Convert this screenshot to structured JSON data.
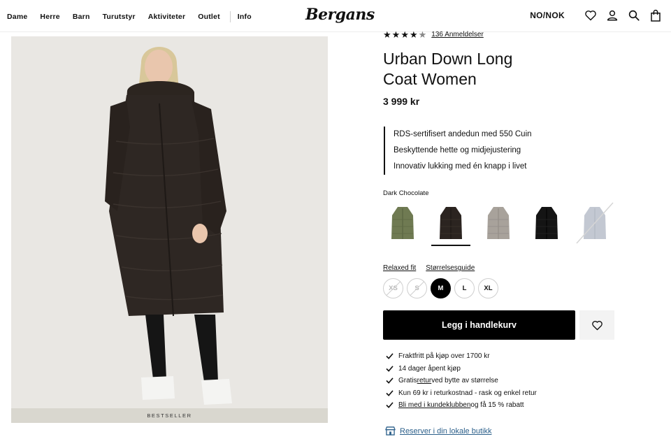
{
  "nav": {
    "items": [
      "Dame",
      "Herre",
      "Barn",
      "Turutstyr",
      "Aktiviteter",
      "Outlet",
      "Info"
    ],
    "logo": "Bergans",
    "locale": "NO/NOK"
  },
  "product": {
    "badge": "BESTSELLER",
    "rating": {
      "stars": 4.5,
      "reviews_label": "136 Anmeldelser"
    },
    "title_line1": "Urban Down Long",
    "title_line2": "Coat Women",
    "price": "3 999 kr",
    "features": [
      "RDS-sertifisert andedun med 550 Cuin",
      "Beskyttende hette og midjejustering",
      "Innovativ lukking med én knapp i livet"
    ],
    "color_label": "Dark Chocolate",
    "swatches": [
      {
        "color": "#6f7a52",
        "selected": false,
        "disabled": false
      },
      {
        "color": "#2b2420",
        "selected": true,
        "disabled": false
      },
      {
        "color": "#a8a29b",
        "selected": false,
        "disabled": false
      },
      {
        "color": "#141414",
        "selected": false,
        "disabled": false
      },
      {
        "color": "#c3c8d2",
        "selected": false,
        "disabled": true
      }
    ],
    "fit_link": "Relaxed fit",
    "size_guide_link": "Størrelsesguide",
    "sizes": [
      {
        "label": "XS",
        "state": "disabled"
      },
      {
        "label": "S",
        "state": "disabled"
      },
      {
        "label": "M",
        "state": "selected"
      },
      {
        "label": "L",
        "state": "available"
      },
      {
        "label": "XL",
        "state": "available"
      }
    ],
    "add_to_cart": "Legg i handlekurv",
    "benefits": {
      "b1": "Fraktfritt på kjøp over 1700 kr",
      "b2": "14 dager åpent kjøp",
      "b3_pre": "Gratis ",
      "b3_link": "retur",
      "b3_post": " ved bytte av størrelse",
      "b4": "Kun 69 kr i returkostnad - rask og enkel retur",
      "b5_link": "Bli med i kundeklubben",
      "b5_post": " og få 15 % rabatt"
    },
    "store_link": "Reserver i din lokale butikk"
  }
}
